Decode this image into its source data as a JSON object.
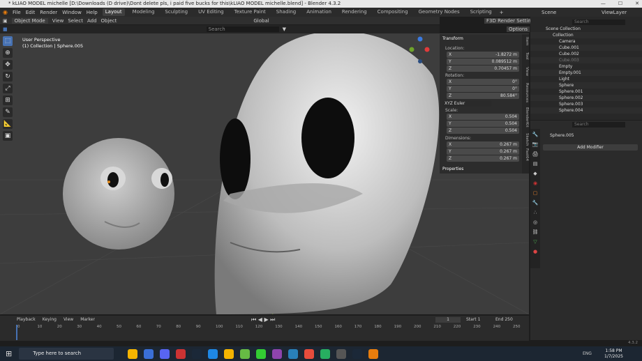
{
  "window": {
    "title": "* kLIAO MODEL michelle [D:\\Downloads (D drive)\\Dont delete pls, i paid five bucks for this\\kLIAO MODEL michelle.blend] - Blender 4.3.2"
  },
  "menu": {
    "items": [
      "File",
      "Edit",
      "Render",
      "Window",
      "Help"
    ]
  },
  "workspaces": [
    "Layout",
    "Modeling",
    "Sculpting",
    "UV Editing",
    "Texture Paint",
    "Shading",
    "Animation",
    "Rendering",
    "Compositing",
    "Geometry Nodes",
    "Scripting"
  ],
  "scene": {
    "label": "Scene",
    "view_layer": "ViewLayer"
  },
  "viewport_header": {
    "mode": "Object Mode",
    "view": "View",
    "select": "Select",
    "add": "Add",
    "object": "Object",
    "orientation": "Global",
    "render_settings": "F3D Render Settings",
    "options": "Options",
    "search_placeholder": "Search"
  },
  "viewport_info": {
    "line1": "User Perspective",
    "line2": "(1) Collection | Sphere.005"
  },
  "npanel": {
    "transform": "Transform",
    "location_label": "Location:",
    "rotation_label": "Rotation:",
    "scale_label": "Scale:",
    "dimensions_label": "Dimensions:",
    "location": {
      "x": "-1.8272 m",
      "y": "0.089512 m",
      "z": "0.70457 m"
    },
    "rotation": {
      "x": "0°",
      "y": "0°",
      "z": "80.584°"
    },
    "rotation_mode": "XYZ Euler",
    "scale": {
      "x": "0.504",
      "y": "0.504",
      "z": "0.504"
    },
    "dimensions": {
      "x": "0.267 m",
      "y": "0.267 m",
      "z": "0.267 m"
    },
    "properties": "Properties",
    "axis_x": "X",
    "axis_y": "Y",
    "axis_z": "Z"
  },
  "ntabs": [
    "Item",
    "Tool",
    "View",
    "Resources",
    "BlenderKit",
    "Sketch",
    "Fast64"
  ],
  "outliner": {
    "search_placeholder": "Search",
    "rows": [
      "Scene Collection",
      "Collection",
      "Camera",
      "Cube.001",
      "Cube.002",
      "Cube.003",
      "Empty",
      "Empty.001",
      "Light",
      "Sphere",
      "Sphere.001",
      "Sphere.002",
      "Sphere.003",
      "Sphere.004"
    ]
  },
  "properties": {
    "object_name": "Sphere.005",
    "add_modifier": "Add Modifier",
    "search_placeholder": "Search"
  },
  "timeline": {
    "playback": "Playback",
    "keying": "Keying",
    "view": "View",
    "marker": "Marker",
    "current_frame": "1",
    "start_label": "Start",
    "start": "1",
    "end_label": "End",
    "end": "250",
    "ticks": [
      "0",
      "10",
      "20",
      "30",
      "40",
      "50",
      "60",
      "70",
      "80",
      "90",
      "100",
      "110",
      "120",
      "130",
      "140",
      "150",
      "160",
      "170",
      "180",
      "190",
      "200",
      "210",
      "220",
      "230",
      "240",
      "250"
    ]
  },
  "statusbar": {
    "version": "4.3.2"
  },
  "taskbar": {
    "search_placeholder": "Type here to search",
    "time": "1:58 PM",
    "date": "1/7/2025",
    "language": "ENG"
  }
}
